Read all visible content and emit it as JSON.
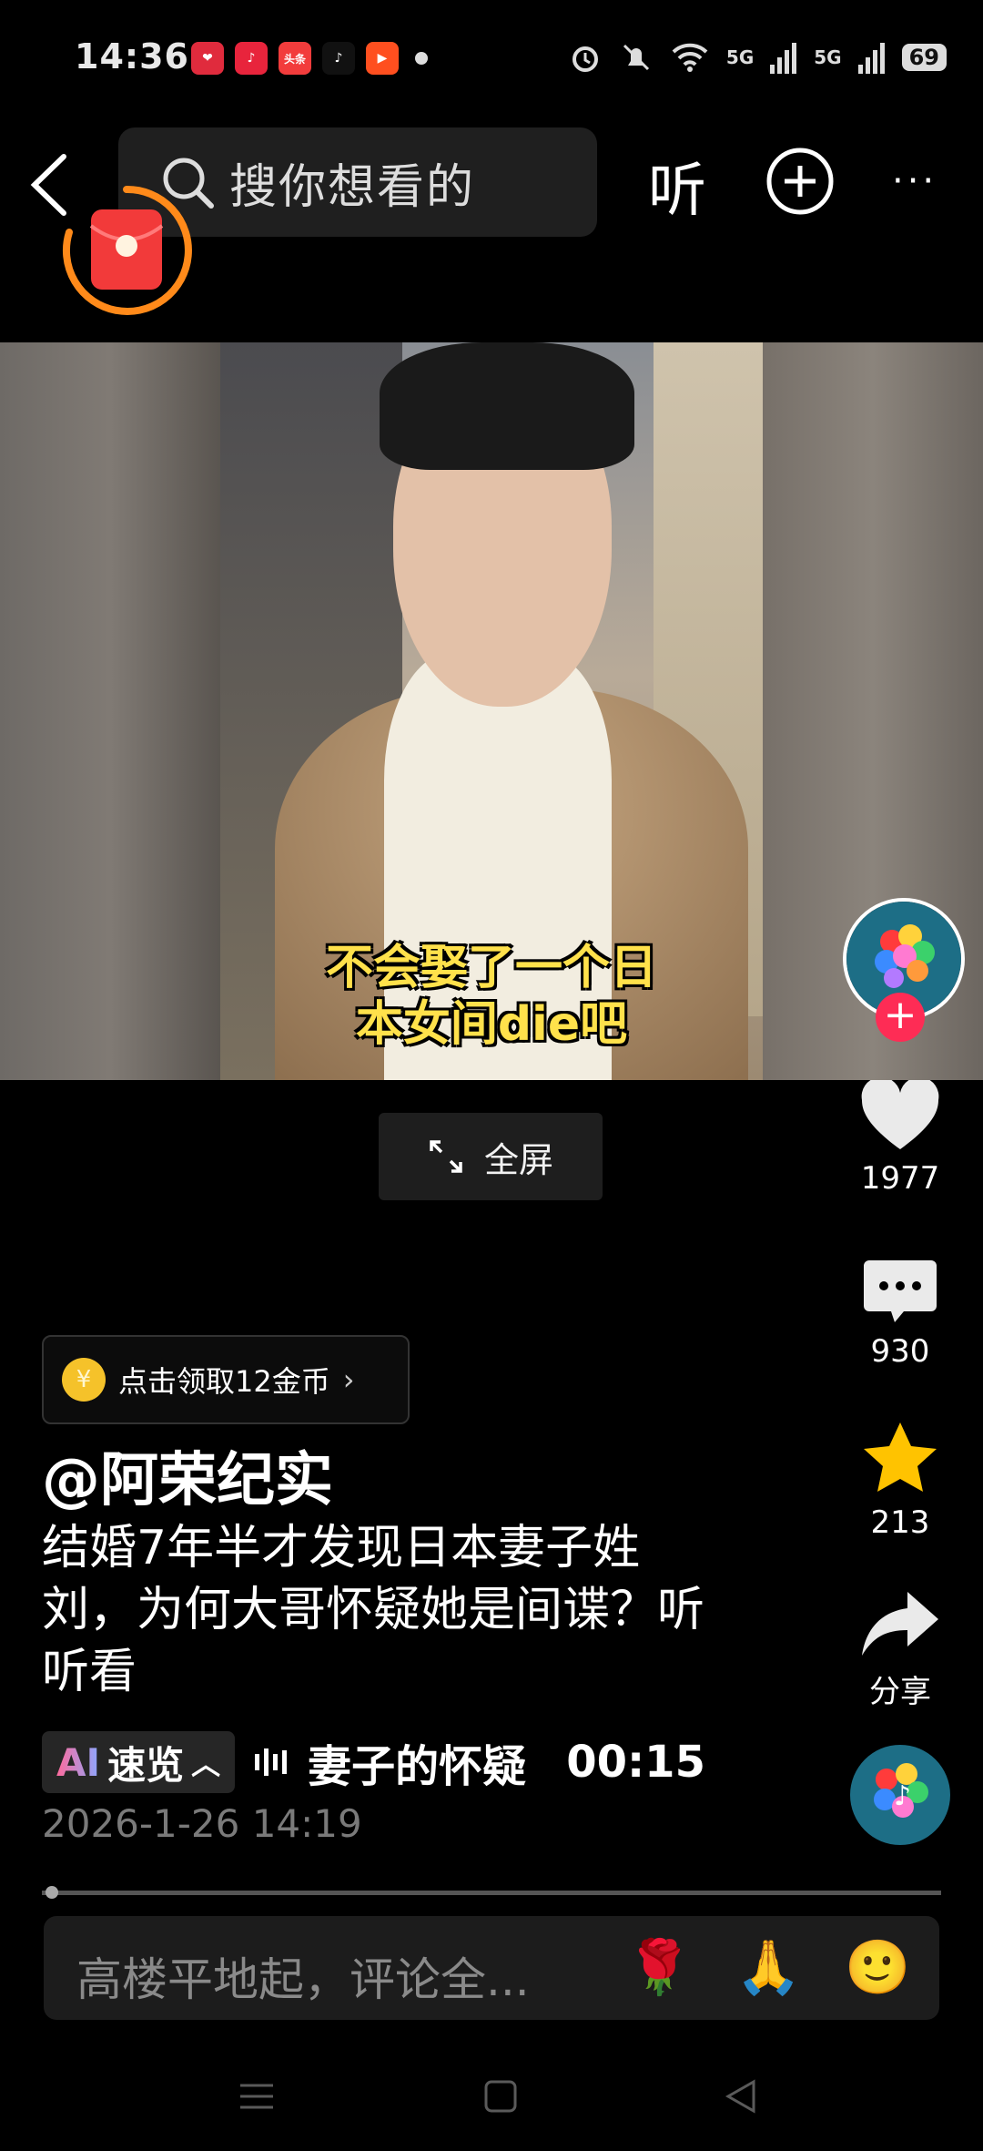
{
  "status_bar": {
    "time": "14:36",
    "app_icons": [
      {
        "name": "app-icon-heart",
        "color": "#e02b3d",
        "label": "❤"
      },
      {
        "name": "app-icon-music",
        "color": "#e8243c",
        "label": "♪"
      },
      {
        "name": "app-icon-toutiao",
        "color": "#f23c3c",
        "label": "头条"
      },
      {
        "name": "app-icon-tiktok",
        "color": "#111111",
        "label": "♪"
      },
      {
        "name": "app-icon-video",
        "color": "#ff4f1f",
        "label": "▶"
      }
    ],
    "net1": "5G",
    "net2": "5G",
    "battery": "69"
  },
  "header": {
    "search_placeholder": "搜你想看的",
    "listen_label": "听"
  },
  "video": {
    "subtitle_line1": "不会娶了一个日",
    "subtitle_line2": "本女间die吧",
    "fullscreen_label": "全屏"
  },
  "rail": {
    "like_count": "1977",
    "comment_count": "930",
    "favorite_count": "213",
    "share_label": "分享"
  },
  "info": {
    "coin_label": "点击领取12金币",
    "author": "@阿荣纪实",
    "description": "结婚7年半才发现日本妻子姓刘，为何大哥怀疑她是间谍？听听看",
    "ai_prefix": "AI",
    "ai_label": "速览",
    "chapter_text": "妻子的怀疑",
    "chapter_time": "00:15",
    "date": "2026-1-26 14:19"
  },
  "comment": {
    "placeholder": "高楼平地起，评论全...",
    "emojis": [
      "🌹",
      "🙏",
      "🙂"
    ]
  },
  "colors": {
    "accent": "#fe2c55",
    "subtitle": "#ffe14b",
    "star": "#ffc300"
  }
}
